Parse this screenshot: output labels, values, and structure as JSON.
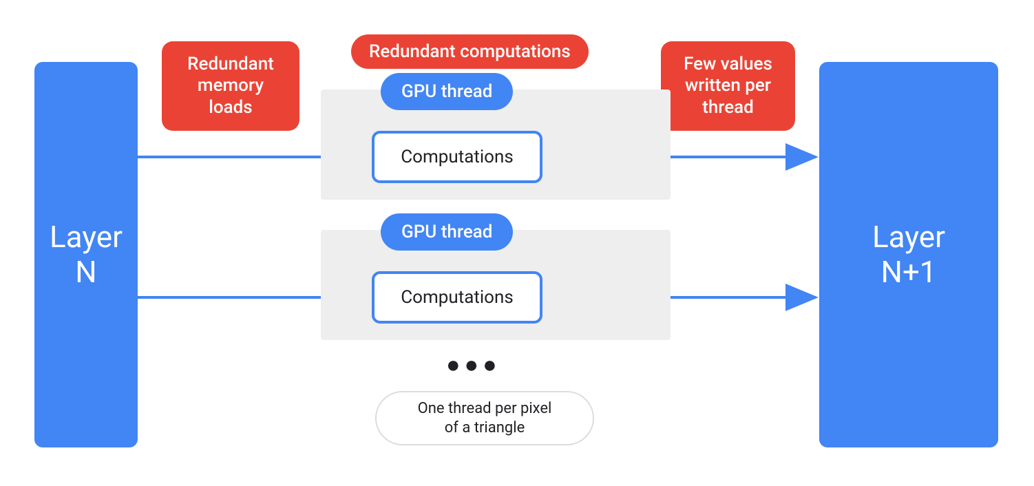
{
  "layers": {
    "left": "Layer\nN",
    "right": "Layer\nN+1"
  },
  "labels": {
    "redundant_memory": "Redundant\nmemory\nloads",
    "redundant_computations": "Redundant computations",
    "few_values": "Few values\nwritten per\nthread",
    "gpu_thread": "GPU thread",
    "computations": "Computations",
    "one_thread_per_pixel": "One thread per pixel\nof a triangle"
  },
  "colors": {
    "blue": "#4285F4",
    "red": "#EA4335",
    "grey_bg": "#EEEEEE",
    "border_grey": "#DADCE0",
    "text_dark": "#202124"
  }
}
